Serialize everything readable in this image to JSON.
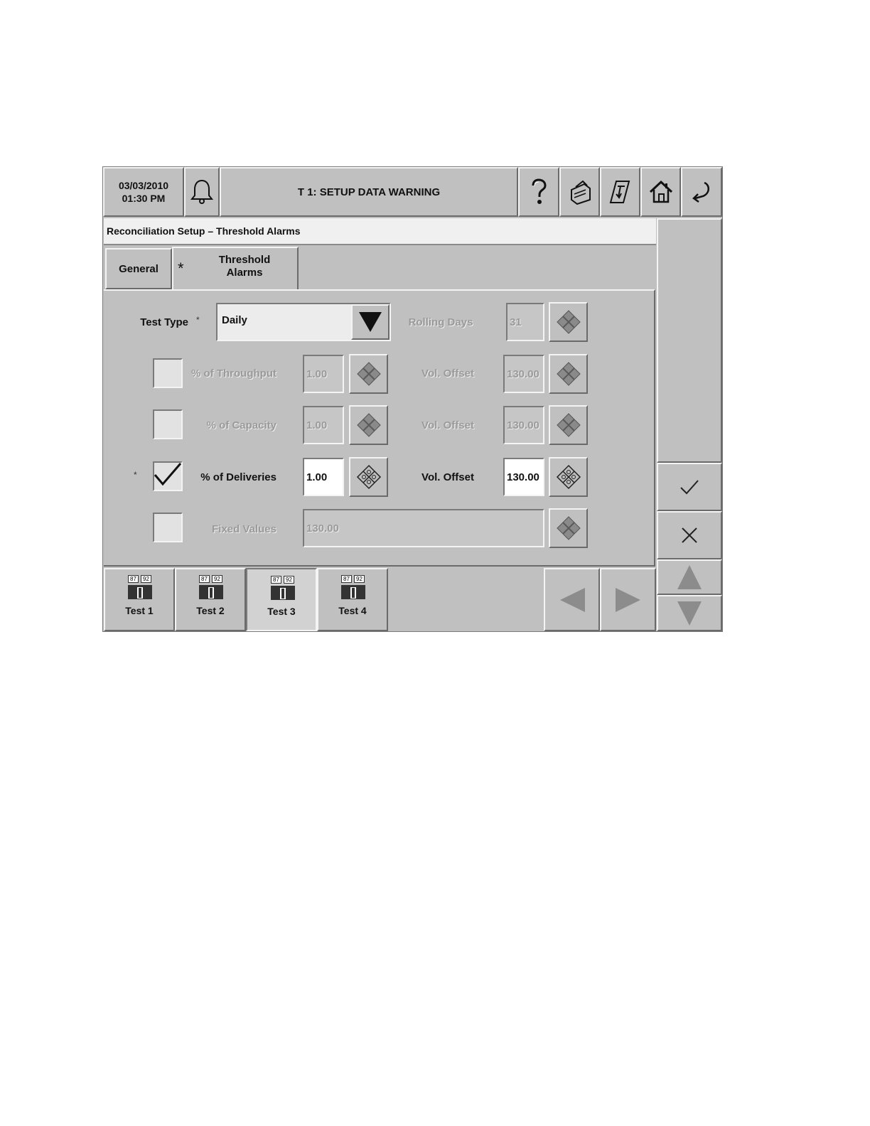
{
  "header": {
    "date": "03/03/2010",
    "time": "01:30 PM",
    "title": "T 1: SETUP DATA WARNING"
  },
  "breadcrumb": "Reconciliation Setup – Threshold Alarms",
  "tabs": {
    "general": "General",
    "threshold_marker": "*",
    "threshold_line1": "Threshold",
    "threshold_line2": "Alarms"
  },
  "form": {
    "test_type_label": "Test Type",
    "test_type_marker": "*",
    "test_type_value": "Daily",
    "rolling_days_label": "Rolling Days",
    "rolling_days_value": "31",
    "rows": [
      {
        "label": "% of Throughput",
        "value": "1.00",
        "offset_label": "Vol. Offset",
        "offset_value": "130.00",
        "checked": false,
        "enabled": false
      },
      {
        "label": "% of Capacity",
        "value": "1.00",
        "offset_label": "Vol. Offset",
        "offset_value": "130.00",
        "checked": false,
        "enabled": false
      },
      {
        "label": "% of Deliveries",
        "value": "1.00",
        "offset_label": "Vol. Offset",
        "offset_value": "130.00",
        "checked": true,
        "enabled": true,
        "marker": "*"
      }
    ],
    "fixed": {
      "label": "Fixed Values",
      "value": "130.00",
      "checked": false,
      "enabled": false
    }
  },
  "bottom_tabs": [
    {
      "label": "Test 1",
      "selected": false
    },
    {
      "label": "Test 2",
      "selected": false
    },
    {
      "label": "Test 3",
      "selected": true
    },
    {
      "label": "Test 4",
      "selected": false
    }
  ],
  "icon_badges": [
    "87",
    "92"
  ],
  "icons": {
    "alarm": "bell-icon",
    "help": "help-icon",
    "printer": "printer-icon",
    "receipt": "receipt-icon",
    "home": "home-icon",
    "back": "back-arrow-icon",
    "accept": "check-icon",
    "cancel": "close-icon",
    "keypad": "keypad-icon",
    "tank": "tank-icon"
  },
  "colors": {
    "panel": "#c0c0c0",
    "title_bar": "#f0f0f0",
    "disabled_text": "#9a9a9a",
    "active_field": "#ffffff"
  }
}
